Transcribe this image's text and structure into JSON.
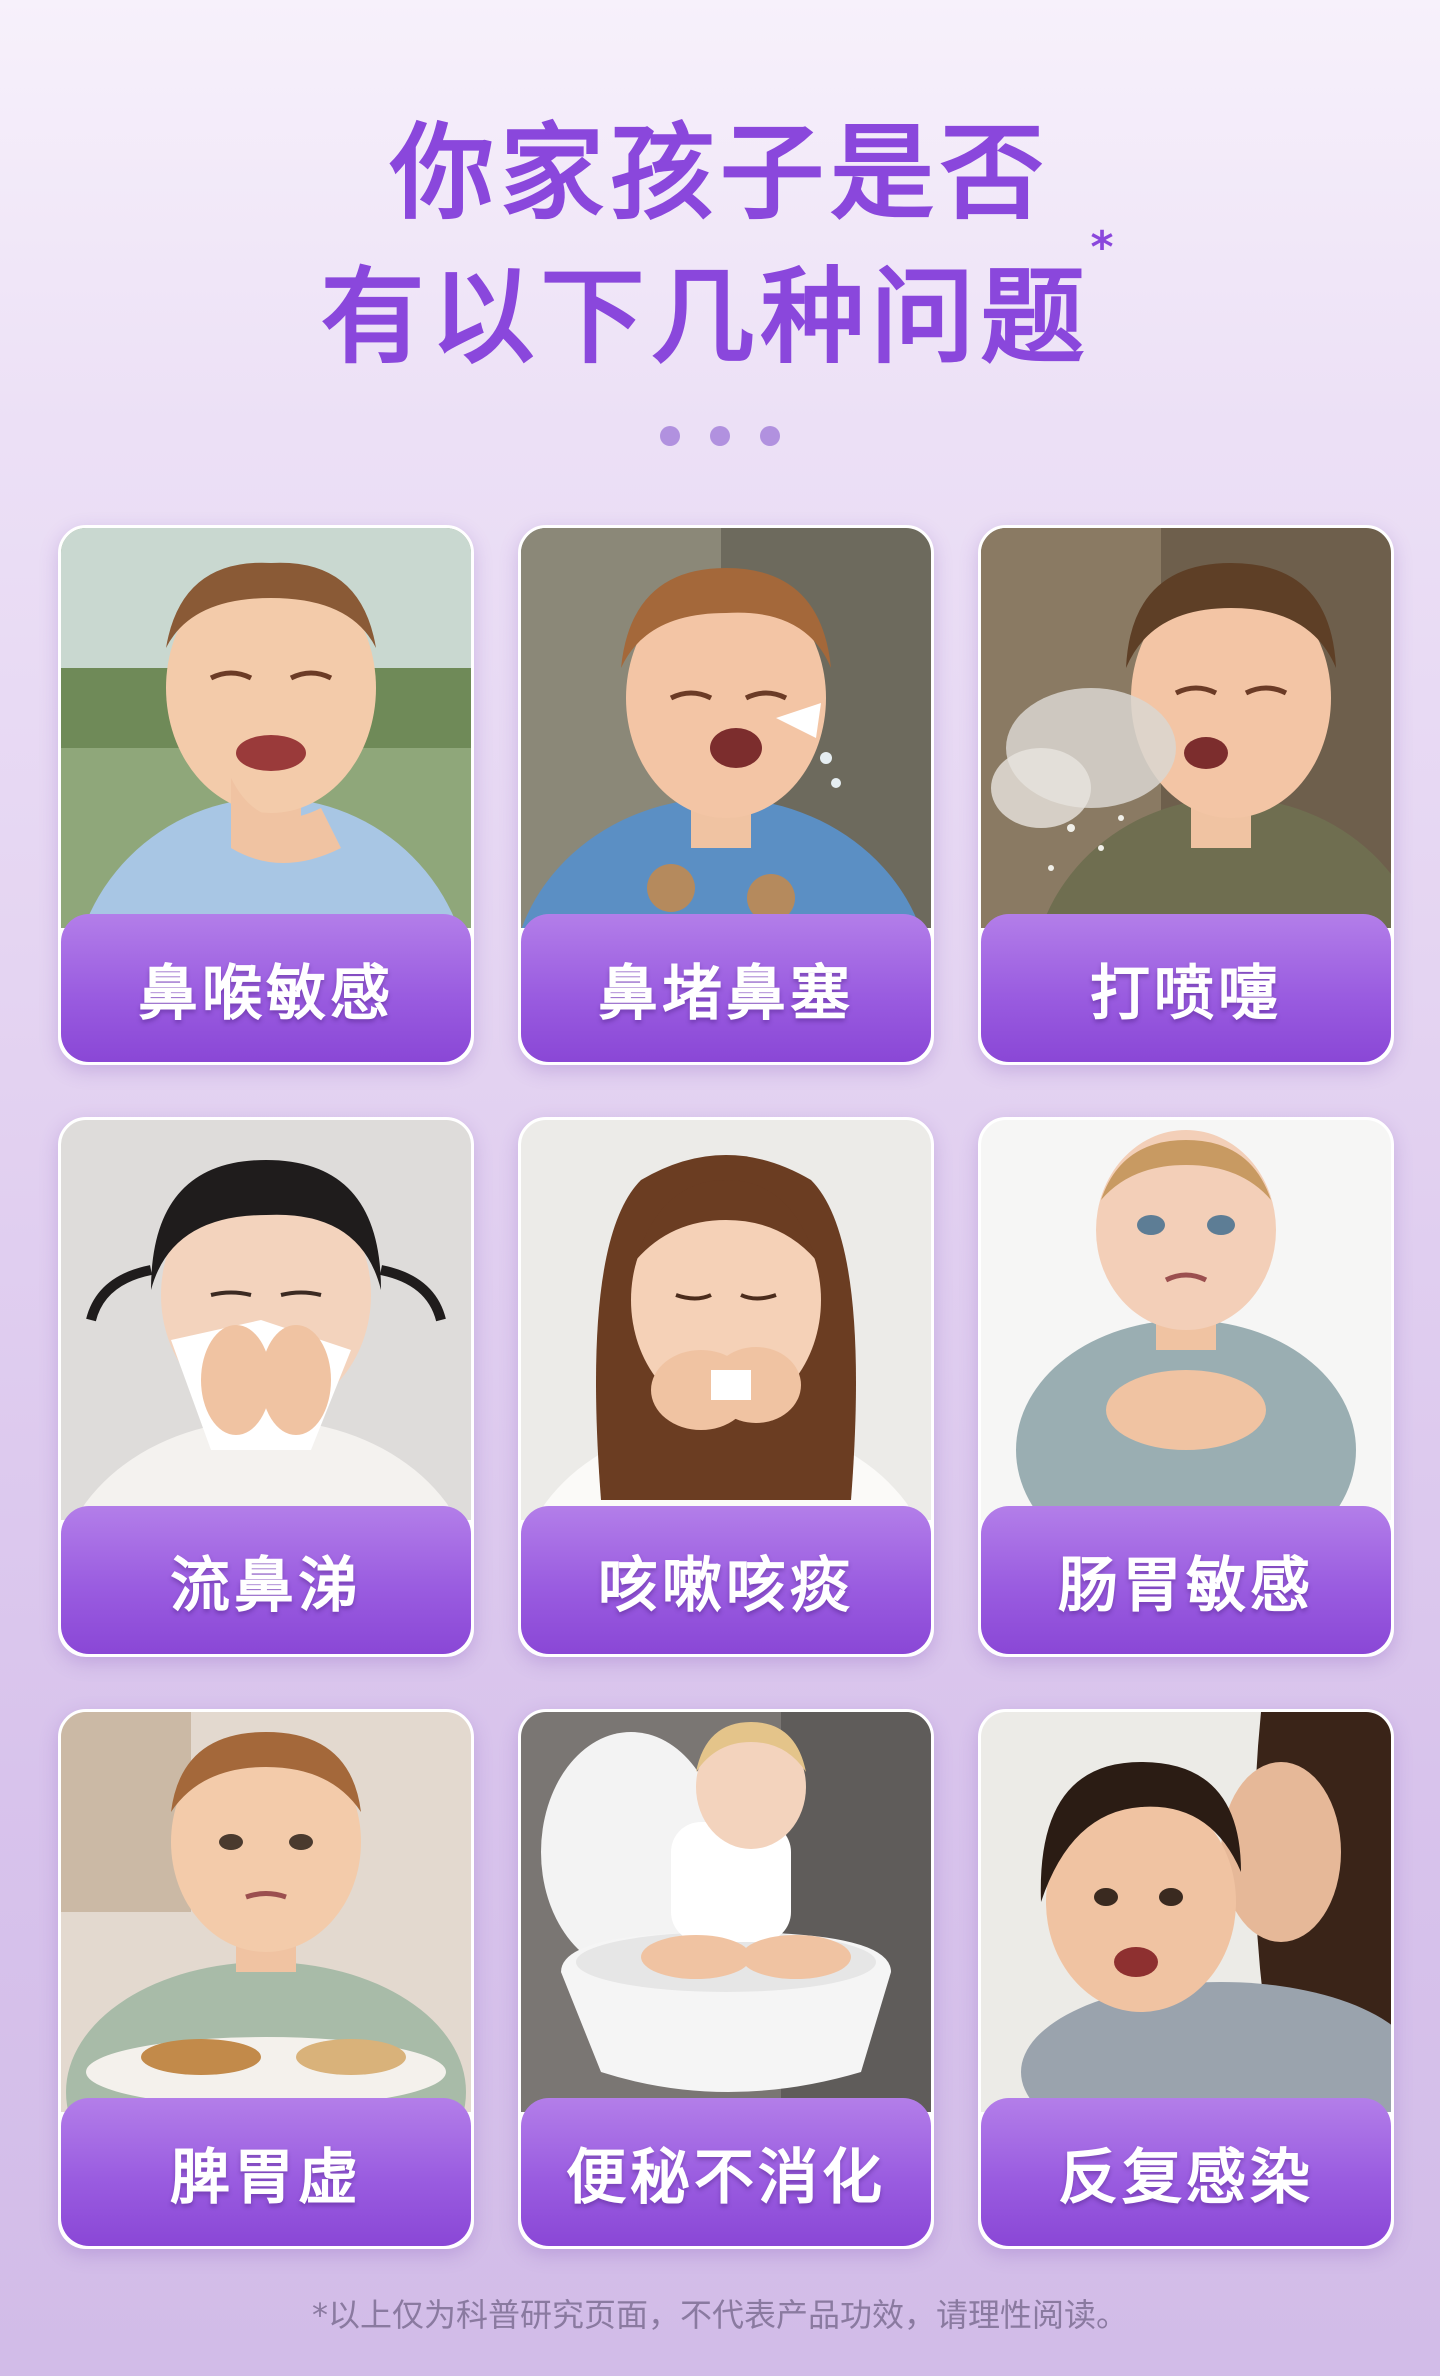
{
  "header": {
    "title_line1": "你家孩子是否",
    "title_line2": "有以下几种问题",
    "title_mark": "*"
  },
  "colors": {
    "title": "#8a47dc",
    "label_bar": "#9a5ce0",
    "dots": "#b191df"
  },
  "cards": [
    {
      "label": "鼻喉敏感",
      "icon": "child-holding-throat-photo"
    },
    {
      "label": "鼻堵鼻塞",
      "icon": "child-blowing-nose-photo"
    },
    {
      "label": "打喷嚏",
      "icon": "child-sneezing-photo"
    },
    {
      "label": "流鼻涕",
      "icon": "girl-with-tissue-photo"
    },
    {
      "label": "咳嗽咳痰",
      "icon": "girl-coughing-photo"
    },
    {
      "label": "肠胃敏感",
      "icon": "toddler-holding-stomach-photo"
    },
    {
      "label": "脾胃虚",
      "icon": "boy-refusing-food-photo"
    },
    {
      "label": "便秘不消化",
      "icon": "toddler-on-toilet-photo"
    },
    {
      "label": "反复感染",
      "icon": "mother-kissing-child-photo"
    }
  ],
  "footnote": "*以上仅为科普研究页面，不代表产品功效，请理性阅读。"
}
